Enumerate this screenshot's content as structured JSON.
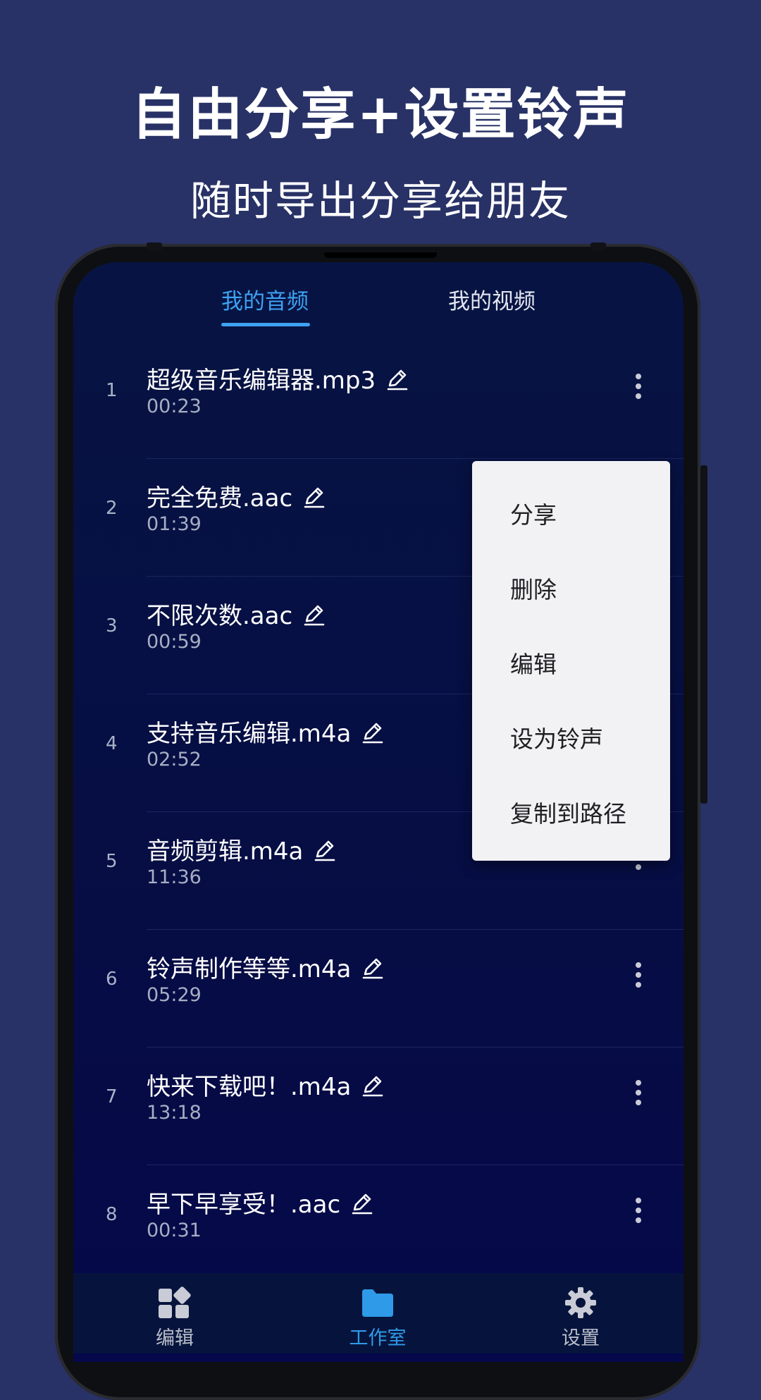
{
  "promo": {
    "headline": "自由分享+设置铃声",
    "subline": "随时导出分享给朋友"
  },
  "tabs": [
    {
      "label": "我的音频",
      "active": true
    },
    {
      "label": "我的视频",
      "active": false
    }
  ],
  "rows": [
    {
      "num": "1",
      "title": "超级音乐编辑器.mp3",
      "duration": "00:23"
    },
    {
      "num": "2",
      "title": "完全免费.aac",
      "duration": "01:39"
    },
    {
      "num": "3",
      "title": "不限次数.aac",
      "duration": "00:59"
    },
    {
      "num": "4",
      "title": "支持音乐编辑.m4a",
      "duration": "02:52"
    },
    {
      "num": "5",
      "title": "音频剪辑.m4a",
      "duration": "11:36"
    },
    {
      "num": "6",
      "title": "铃声制作等等.m4a",
      "duration": "05:29"
    },
    {
      "num": "7",
      "title": "快来下载吧！.m4a",
      "duration": "13:18"
    },
    {
      "num": "8",
      "title": "早下早享受！.aac",
      "duration": "00:31"
    }
  ],
  "context_menu": {
    "items": [
      "分享",
      "删除",
      "编辑",
      "设为铃声",
      "复制到路径"
    ]
  },
  "bottom_nav": [
    {
      "label": "编辑",
      "icon": "grid-shapes-icon",
      "active": false
    },
    {
      "label": "工作室",
      "icon": "folder-icon",
      "active": true
    },
    {
      "label": "设置",
      "icon": "gear-icon",
      "active": false
    }
  ],
  "colors": {
    "background": "#283266",
    "accent": "#3ea2f2",
    "screen": "#071443"
  }
}
